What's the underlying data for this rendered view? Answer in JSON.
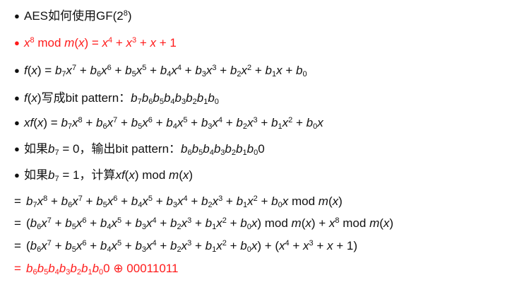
{
  "colors": {
    "text": "#111111",
    "highlight": "#ff1a1a"
  },
  "symbols": {
    "bullet": "●",
    "equals": "="
  },
  "lines": [
    {
      "type": "bullet",
      "color": "text",
      "segments": [
        {
          "t": "AES如何使用GF(2"
        },
        {
          "t": "8",
          "sup": true
        },
        {
          "t": ")"
        }
      ]
    },
    {
      "type": "bullet",
      "color": "highlight",
      "segments": [
        {
          "t": "x",
          "i": true
        },
        {
          "t": "8",
          "sup": true
        },
        {
          "t": " mod "
        },
        {
          "t": "m",
          "i": true
        },
        {
          "t": "("
        },
        {
          "t": "x",
          "i": true
        },
        {
          "t": ") = "
        },
        {
          "t": "x",
          "i": true
        },
        {
          "t": "4",
          "sup": true
        },
        {
          "t": " + "
        },
        {
          "t": "x",
          "i": true
        },
        {
          "t": "3",
          "sup": true
        },
        {
          "t": " + "
        },
        {
          "t": "x",
          "i": true
        },
        {
          "t": " + 1"
        }
      ]
    },
    {
      "type": "bullet",
      "color": "text",
      "segments": [
        {
          "t": "f",
          "i": true
        },
        {
          "t": "("
        },
        {
          "t": "x",
          "i": true
        },
        {
          "t": ") = "
        },
        {
          "t": "b",
          "i": true
        },
        {
          "t": "7",
          "sub": true
        },
        {
          "t": "x",
          "i": true
        },
        {
          "t": "7",
          "sup": true
        },
        {
          "t": " + "
        },
        {
          "t": "b",
          "i": true
        },
        {
          "t": "6",
          "sub": true
        },
        {
          "t": "x",
          "i": true
        },
        {
          "t": "6",
          "sup": true
        },
        {
          "t": " + "
        },
        {
          "t": "b",
          "i": true
        },
        {
          "t": "5",
          "sub": true
        },
        {
          "t": "x",
          "i": true
        },
        {
          "t": "5",
          "sup": true
        },
        {
          "t": " + "
        },
        {
          "t": "b",
          "i": true
        },
        {
          "t": "4",
          "sub": true
        },
        {
          "t": "x",
          "i": true
        },
        {
          "t": "4",
          "sup": true
        },
        {
          "t": " + "
        },
        {
          "t": "b",
          "i": true
        },
        {
          "t": "3",
          "sub": true
        },
        {
          "t": "x",
          "i": true
        },
        {
          "t": "3",
          "sup": true
        },
        {
          "t": " + "
        },
        {
          "t": "b",
          "i": true
        },
        {
          "t": "2",
          "sub": true
        },
        {
          "t": "x",
          "i": true
        },
        {
          "t": "2",
          "sup": true
        },
        {
          "t": " + "
        },
        {
          "t": "b",
          "i": true
        },
        {
          "t": "1",
          "sub": true
        },
        {
          "t": "x",
          "i": true
        },
        {
          "t": " + "
        },
        {
          "t": "b",
          "i": true
        },
        {
          "t": "0",
          "sub": true
        }
      ]
    },
    {
      "type": "bullet",
      "color": "text",
      "segments": [
        {
          "t": "f",
          "i": true
        },
        {
          "t": "("
        },
        {
          "t": "x",
          "i": true
        },
        {
          "t": ")写成bit pattern："
        },
        {
          "t": "b",
          "i": true
        },
        {
          "t": "7",
          "sub": true
        },
        {
          "t": "b",
          "i": true
        },
        {
          "t": "6",
          "sub": true
        },
        {
          "t": "b",
          "i": true
        },
        {
          "t": "5",
          "sub": true
        },
        {
          "t": "b",
          "i": true
        },
        {
          "t": "4",
          "sub": true
        },
        {
          "t": "b",
          "i": true
        },
        {
          "t": "3",
          "sub": true
        },
        {
          "t": "b",
          "i": true
        },
        {
          "t": "2",
          "sub": true
        },
        {
          "t": "b",
          "i": true
        },
        {
          "t": "1",
          "sub": true
        },
        {
          "t": "b",
          "i": true
        },
        {
          "t": "0",
          "sub": true
        }
      ]
    },
    {
      "type": "bullet",
      "color": "text",
      "segments": [
        {
          "t": "xf",
          "i": true
        },
        {
          "t": "("
        },
        {
          "t": "x",
          "i": true
        },
        {
          "t": ") = "
        },
        {
          "t": "b",
          "i": true
        },
        {
          "t": "7",
          "sub": true
        },
        {
          "t": "x",
          "i": true
        },
        {
          "t": "8",
          "sup": true
        },
        {
          "t": " + "
        },
        {
          "t": "b",
          "i": true
        },
        {
          "t": "6",
          "sub": true
        },
        {
          "t": "x",
          "i": true
        },
        {
          "t": "7",
          "sup": true
        },
        {
          "t": " + "
        },
        {
          "t": "b",
          "i": true
        },
        {
          "t": "5",
          "sub": true
        },
        {
          "t": "x",
          "i": true
        },
        {
          "t": "6",
          "sup": true
        },
        {
          "t": " + "
        },
        {
          "t": "b",
          "i": true
        },
        {
          "t": "4",
          "sub": true
        },
        {
          "t": "x",
          "i": true
        },
        {
          "t": "5",
          "sup": true
        },
        {
          "t": " + "
        },
        {
          "t": "b",
          "i": true
        },
        {
          "t": "3",
          "sub": true
        },
        {
          "t": "x",
          "i": true
        },
        {
          "t": "4",
          "sup": true
        },
        {
          "t": " + "
        },
        {
          "t": "b",
          "i": true
        },
        {
          "t": "2",
          "sub": true
        },
        {
          "t": "x",
          "i": true
        },
        {
          "t": "3",
          "sup": true
        },
        {
          "t": " + "
        },
        {
          "t": "b",
          "i": true
        },
        {
          "t": "1",
          "sub": true
        },
        {
          "t": "x",
          "i": true
        },
        {
          "t": "2",
          "sup": true
        },
        {
          "t": " + "
        },
        {
          "t": "b",
          "i": true
        },
        {
          "t": "0",
          "sub": true
        },
        {
          "t": "x",
          "i": true
        }
      ]
    },
    {
      "type": "bullet",
      "color": "text",
      "segments": [
        {
          "t": "如果"
        },
        {
          "t": "b",
          "i": true
        },
        {
          "t": "7",
          "sub": true
        },
        {
          "t": " = 0，输出bit pattern："
        },
        {
          "t": "b",
          "i": true
        },
        {
          "t": "6",
          "sub": true
        },
        {
          "t": "b",
          "i": true
        },
        {
          "t": "5",
          "sub": true
        },
        {
          "t": "b",
          "i": true
        },
        {
          "t": "4",
          "sub": true
        },
        {
          "t": "b",
          "i": true
        },
        {
          "t": "3",
          "sub": true
        },
        {
          "t": "b",
          "i": true
        },
        {
          "t": "2",
          "sub": true
        },
        {
          "t": "b",
          "i": true
        },
        {
          "t": "1",
          "sub": true
        },
        {
          "t": "b",
          "i": true
        },
        {
          "t": "0",
          "sub": true
        },
        {
          "t": "0"
        }
      ]
    },
    {
      "type": "bullet",
      "color": "text",
      "segments": [
        {
          "t": "如果"
        },
        {
          "t": "b",
          "i": true
        },
        {
          "t": "7",
          "sub": true
        },
        {
          "t": " = 1，计算"
        },
        {
          "t": "xf",
          "i": true
        },
        {
          "t": "("
        },
        {
          "t": "x",
          "i": true
        },
        {
          "t": ") mod "
        },
        {
          "t": "m",
          "i": true
        },
        {
          "t": "("
        },
        {
          "t": "x",
          "i": true
        },
        {
          "t": ")"
        }
      ]
    },
    {
      "type": "equals",
      "color": "text",
      "segments": [
        {
          "t": "b",
          "i": true
        },
        {
          "t": "7",
          "sub": true
        },
        {
          "t": "x",
          "i": true
        },
        {
          "t": "8",
          "sup": true
        },
        {
          "t": " + "
        },
        {
          "t": "b",
          "i": true
        },
        {
          "t": "6",
          "sub": true
        },
        {
          "t": "x",
          "i": true
        },
        {
          "t": "7",
          "sup": true
        },
        {
          "t": " + "
        },
        {
          "t": "b",
          "i": true
        },
        {
          "t": "5",
          "sub": true
        },
        {
          "t": "x",
          "i": true
        },
        {
          "t": "6",
          "sup": true
        },
        {
          "t": " + "
        },
        {
          "t": "b",
          "i": true
        },
        {
          "t": "4",
          "sub": true
        },
        {
          "t": "x",
          "i": true
        },
        {
          "t": "5",
          "sup": true
        },
        {
          "t": " + "
        },
        {
          "t": "b",
          "i": true
        },
        {
          "t": "3",
          "sub": true
        },
        {
          "t": "x",
          "i": true
        },
        {
          "t": "4",
          "sup": true
        },
        {
          "t": " + "
        },
        {
          "t": "b",
          "i": true
        },
        {
          "t": "2",
          "sub": true
        },
        {
          "t": "x",
          "i": true
        },
        {
          "t": "3",
          "sup": true
        },
        {
          "t": " + "
        },
        {
          "t": "b",
          "i": true
        },
        {
          "t": "1",
          "sub": true
        },
        {
          "t": "x",
          "i": true
        },
        {
          "t": "2",
          "sup": true
        },
        {
          "t": " + "
        },
        {
          "t": "b",
          "i": true
        },
        {
          "t": "0",
          "sub": true
        },
        {
          "t": "x",
          "i": true
        },
        {
          "t": " mod "
        },
        {
          "t": "m",
          "i": true
        },
        {
          "t": "("
        },
        {
          "t": "x",
          "i": true
        },
        {
          "t": ")"
        }
      ]
    },
    {
      "type": "equals",
      "color": "text",
      "segments": [
        {
          "t": "("
        },
        {
          "t": "b",
          "i": true
        },
        {
          "t": "6",
          "sub": true
        },
        {
          "t": "x",
          "i": true
        },
        {
          "t": "7",
          "sup": true
        },
        {
          "t": " + "
        },
        {
          "t": "b",
          "i": true
        },
        {
          "t": "5",
          "sub": true
        },
        {
          "t": "x",
          "i": true
        },
        {
          "t": "6",
          "sup": true
        },
        {
          "t": " + "
        },
        {
          "t": "b",
          "i": true
        },
        {
          "t": "4",
          "sub": true
        },
        {
          "t": "x",
          "i": true
        },
        {
          "t": "5",
          "sup": true
        },
        {
          "t": " + "
        },
        {
          "t": "b",
          "i": true
        },
        {
          "t": "3",
          "sub": true
        },
        {
          "t": "x",
          "i": true
        },
        {
          "t": "4",
          "sup": true
        },
        {
          "t": " + "
        },
        {
          "t": "b",
          "i": true
        },
        {
          "t": "2",
          "sub": true
        },
        {
          "t": "x",
          "i": true
        },
        {
          "t": "3",
          "sup": true
        },
        {
          "t": " + "
        },
        {
          "t": "b",
          "i": true
        },
        {
          "t": "1",
          "sub": true
        },
        {
          "t": "x",
          "i": true
        },
        {
          "t": "2",
          "sup": true
        },
        {
          "t": " + "
        },
        {
          "t": "b",
          "i": true
        },
        {
          "t": "0",
          "sub": true
        },
        {
          "t": "x",
          "i": true
        },
        {
          "t": ") mod "
        },
        {
          "t": "m",
          "i": true
        },
        {
          "t": "("
        },
        {
          "t": "x",
          "i": true
        },
        {
          "t": ") + "
        },
        {
          "t": "x",
          "i": true
        },
        {
          "t": "8",
          "sup": true
        },
        {
          "t": " mod "
        },
        {
          "t": "m",
          "i": true
        },
        {
          "t": "("
        },
        {
          "t": "x",
          "i": true
        },
        {
          "t": ")"
        }
      ]
    },
    {
      "type": "equals",
      "color": "text",
      "segments": [
        {
          "t": "("
        },
        {
          "t": "b",
          "i": true
        },
        {
          "t": "6",
          "sub": true
        },
        {
          "t": "x",
          "i": true
        },
        {
          "t": "7",
          "sup": true
        },
        {
          "t": " + "
        },
        {
          "t": "b",
          "i": true
        },
        {
          "t": "5",
          "sub": true
        },
        {
          "t": "x",
          "i": true
        },
        {
          "t": "6",
          "sup": true
        },
        {
          "t": " + "
        },
        {
          "t": "b",
          "i": true
        },
        {
          "t": "4",
          "sub": true
        },
        {
          "t": "x",
          "i": true
        },
        {
          "t": "5",
          "sup": true
        },
        {
          "t": " + "
        },
        {
          "t": "b",
          "i": true
        },
        {
          "t": "3",
          "sub": true
        },
        {
          "t": "x",
          "i": true
        },
        {
          "t": "4",
          "sup": true
        },
        {
          "t": " + "
        },
        {
          "t": "b",
          "i": true
        },
        {
          "t": "2",
          "sub": true
        },
        {
          "t": "x",
          "i": true
        },
        {
          "t": "3",
          "sup": true
        },
        {
          "t": " + "
        },
        {
          "t": "b",
          "i": true
        },
        {
          "t": "1",
          "sub": true
        },
        {
          "t": "x",
          "i": true
        },
        {
          "t": "2",
          "sup": true
        },
        {
          "t": " + "
        },
        {
          "t": "b",
          "i": true
        },
        {
          "t": "0",
          "sub": true
        },
        {
          "t": "x",
          "i": true
        },
        {
          "t": ") + ("
        },
        {
          "t": "x",
          "i": true
        },
        {
          "t": "4",
          "sup": true
        },
        {
          "t": " + "
        },
        {
          "t": "x",
          "i": true
        },
        {
          "t": "3",
          "sup": true
        },
        {
          "t": " + "
        },
        {
          "t": "x",
          "i": true
        },
        {
          "t": " + 1)"
        }
      ]
    },
    {
      "type": "equals",
      "color": "highlight",
      "segments": [
        {
          "t": "b",
          "i": true
        },
        {
          "t": "6",
          "sub": true
        },
        {
          "t": "b",
          "i": true
        },
        {
          "t": "5",
          "sub": true
        },
        {
          "t": "b",
          "i": true
        },
        {
          "t": "4",
          "sub": true
        },
        {
          "t": "b",
          "i": true
        },
        {
          "t": "3",
          "sub": true
        },
        {
          "t": "b",
          "i": true
        },
        {
          "t": "2",
          "sub": true
        },
        {
          "t": "b",
          "i": true
        },
        {
          "t": "1",
          "sub": true
        },
        {
          "t": "b",
          "i": true
        },
        {
          "t": "0",
          "sub": true
        },
        {
          "t": "0 ⊕ 00011011"
        }
      ]
    }
  ]
}
